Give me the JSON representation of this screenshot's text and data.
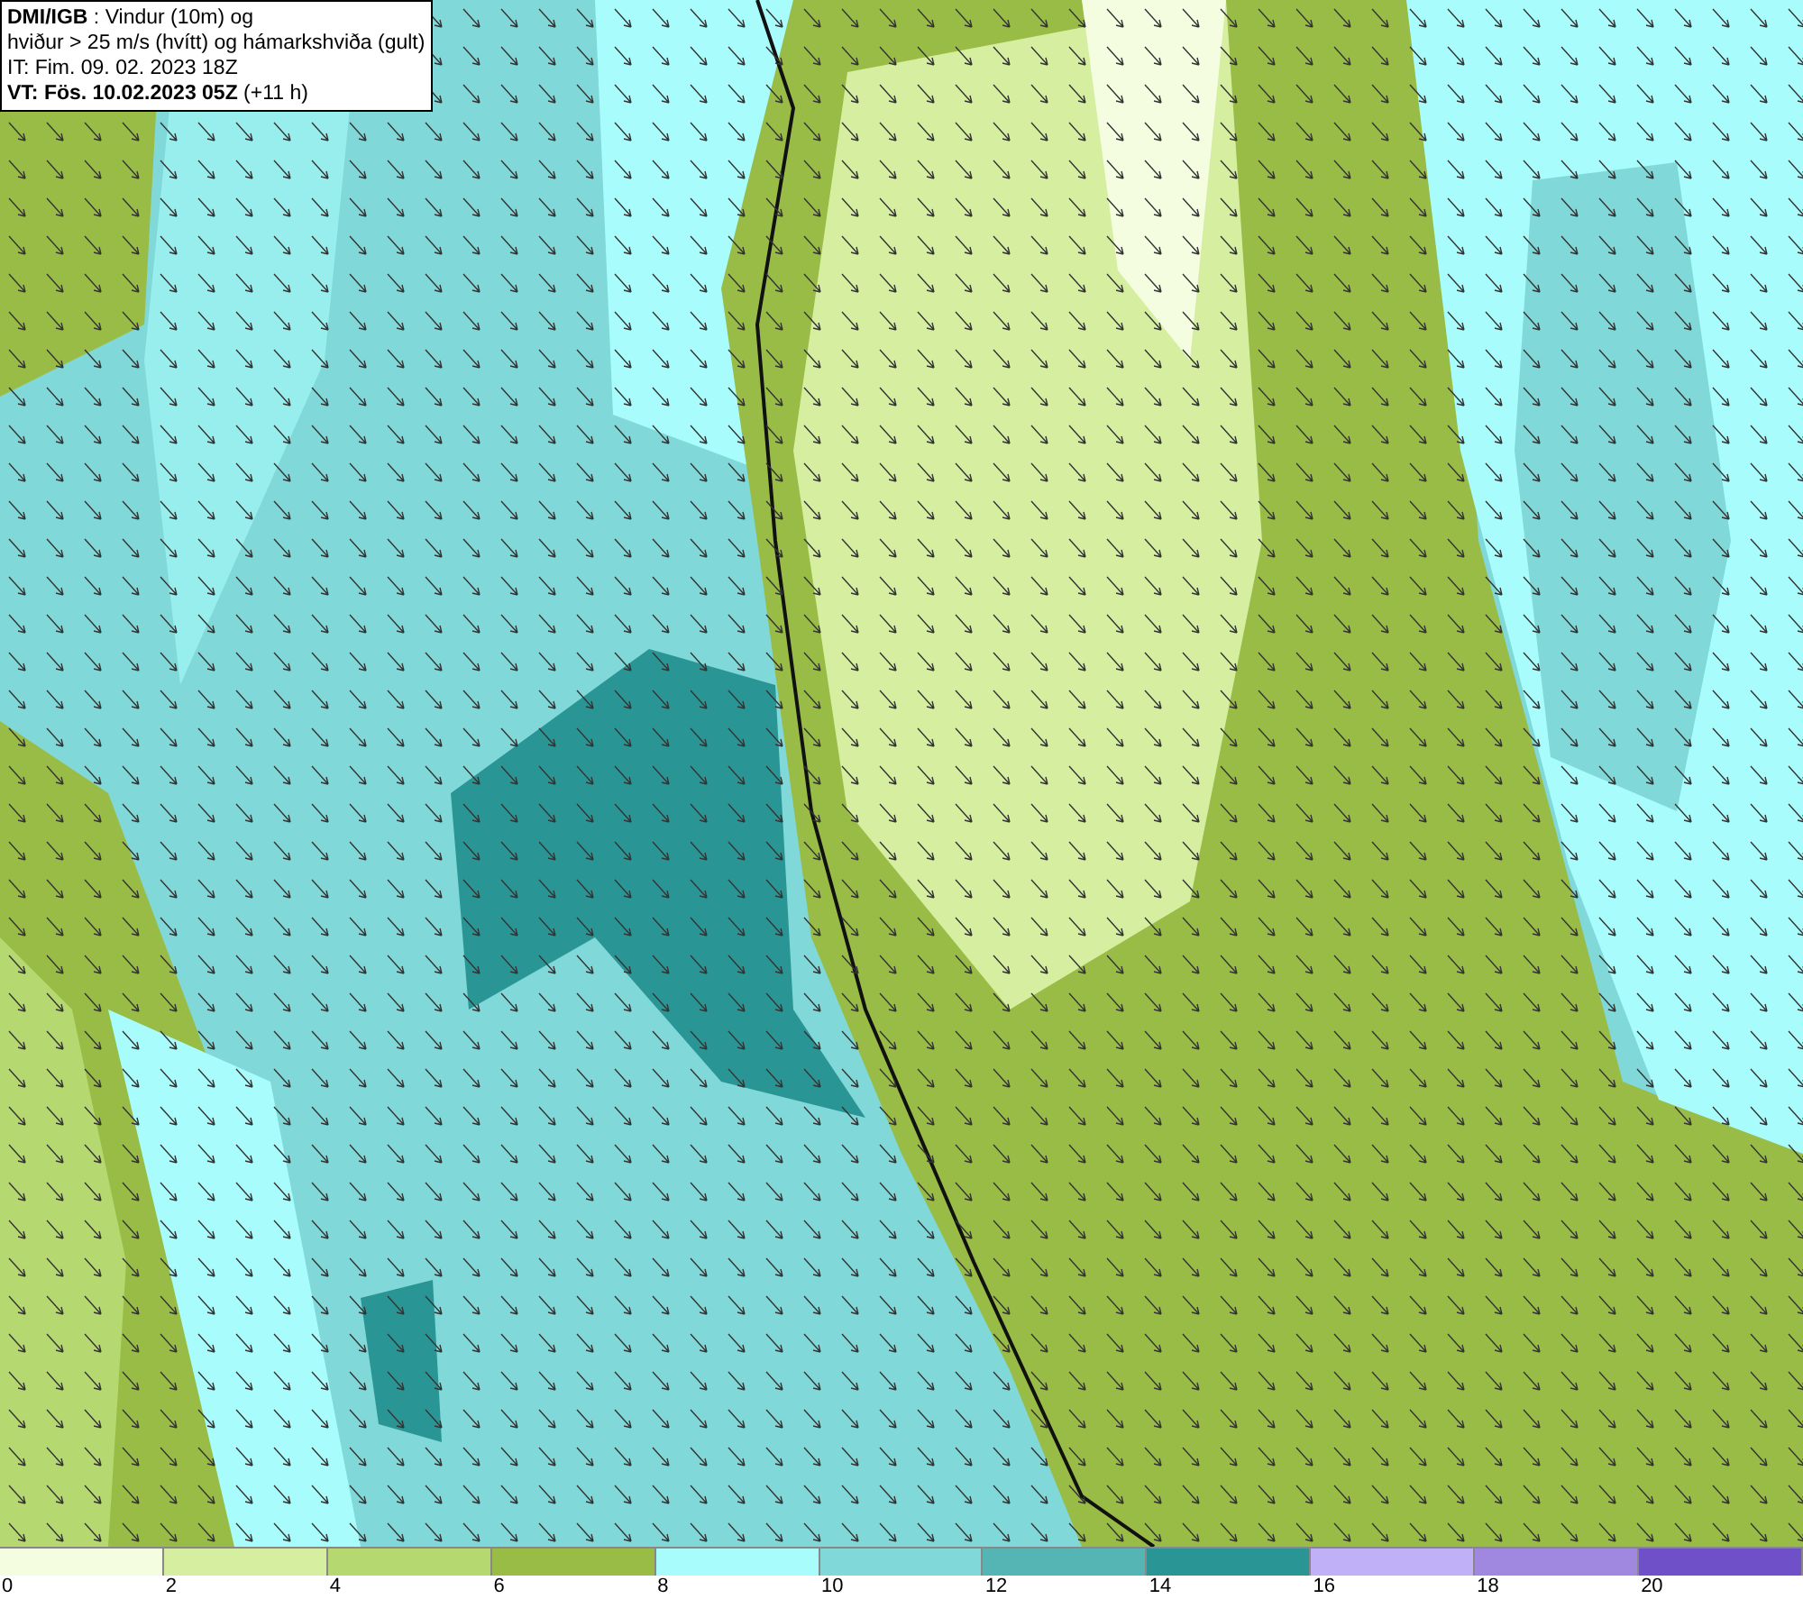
{
  "header": {
    "lines": [
      "**DMI/IGB** : Vindur (10m) og",
      "hviður > 25 m/s (hvítt) og hámarkshviða (gult)",
      "IT: Fim. 09. 02. 2023 18Z",
      "**VT: Fös. 10.02.2023 05Z** (+11 h)"
    ]
  },
  "legend": {
    "bins": [
      {
        "label": "0",
        "color": "#f5fde0"
      },
      {
        "label": "2",
        "color": "#d5eea0"
      },
      {
        "label": "4",
        "color": "#b5d870"
      },
      {
        "label": "6",
        "color": "#98bc45"
      },
      {
        "label": "8",
        "color": "#a8fcfc"
      },
      {
        "label": "10",
        "color": "#80d8d8"
      },
      {
        "label": "12",
        "color": "#55b5b5"
      },
      {
        "label": "14",
        "color": "#2a9595"
      },
      {
        "label": "16",
        "color": "#c0b0f8"
      },
      {
        "label": "18",
        "color": "#a088e0"
      },
      {
        "label": "20",
        "color": "#7050c8"
      }
    ]
  }
}
